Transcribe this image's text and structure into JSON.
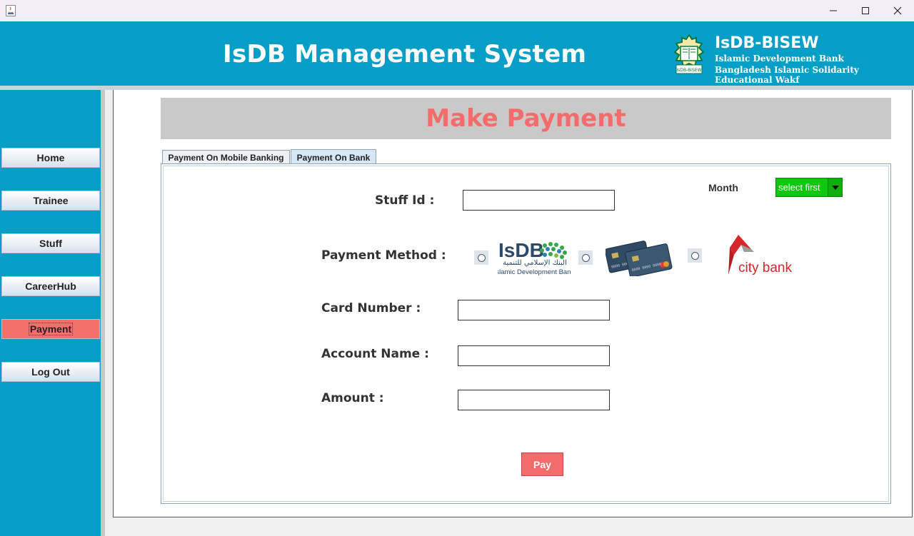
{
  "window": {
    "app_icon": "java-icon",
    "controls": {
      "minimize": "—",
      "maximize": "☐",
      "close": "✕"
    }
  },
  "header": {
    "title": "IsDB Management System",
    "org_name": "IsDB-BISEW",
    "org_line1": "Islamic Development Bank",
    "org_line2": "Bangladesh Islamic Solidarity Educational Wakf",
    "logo_text": "IsDB-BISEW",
    "bg_color": "#049ec6"
  },
  "sidebar": {
    "items": [
      {
        "label": "Home",
        "active": false
      },
      {
        "label": "Trainee",
        "active": false
      },
      {
        "label": "Stuff",
        "active": false
      },
      {
        "label": "CareerHub",
        "active": false
      },
      {
        "label": "Payment",
        "active": true
      },
      {
        "label": "Log Out",
        "active": false
      }
    ]
  },
  "main": {
    "heading": "Make Payment",
    "heading_color": "#f46b6b",
    "tabs": [
      {
        "label": "Payment On Mobile Banking",
        "active": false
      },
      {
        "label": "Payment On Bank",
        "active": true
      }
    ],
    "month": {
      "label": "Month",
      "selected": "select first"
    },
    "form": {
      "stuff_id_label": "Stuff Id :",
      "stuff_id_value": "",
      "payment_method_label": "Payment Method :",
      "card_number_label": "Card Number :",
      "card_number_value": "",
      "account_name_label": "Account Name :",
      "account_name_value": "",
      "amount_label": "Amount :",
      "amount_value": ""
    },
    "payment_methods": [
      {
        "name": "isdb",
        "logo_text": "IsDB",
        "arabic": "البنك الإسلامي للتنمية",
        "caption": "Islamic Development Bank"
      },
      {
        "name": "card",
        "logo_text": "credit cards"
      },
      {
        "name": "citybank",
        "logo_text": "city bank"
      }
    ],
    "pay_label": "Pay",
    "accent_color": "#f46b6b",
    "month_select_color": "#10c710"
  }
}
